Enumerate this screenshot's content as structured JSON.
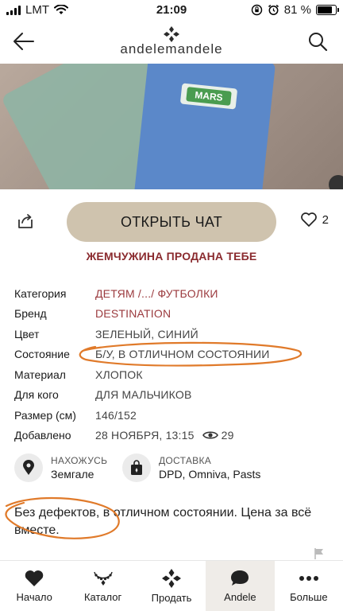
{
  "status_bar": {
    "carrier": "LMT",
    "time": "21:09",
    "battery": "81 %",
    "battery_level": 0.81
  },
  "header": {
    "logo_text": "andelemandele",
    "back_icon": "back-arrow-icon",
    "search_icon": "search-icon"
  },
  "product_image": {
    "patch_text": "MARS"
  },
  "actions": {
    "chat_label": "ОТКРЫТЬ ЧАТ",
    "like_count": "2"
  },
  "sold_note": "ЖЕМЧУЖИНА ПРОДАНА ТЕБЕ",
  "details": [
    {
      "label": "Категория",
      "value": "ДЕТЯМ /.../ ФУТБОЛКИ",
      "link": true
    },
    {
      "label": "Бренд",
      "value": "DESTINATION",
      "link": true
    },
    {
      "label": "Цвет",
      "value": "ЗЕЛЕНЫЙ, СИНИЙ",
      "link": false
    },
    {
      "label": "Состояние",
      "value": "Б/У, В ОТЛИЧНОМ СОСТОЯНИИ",
      "link": false
    },
    {
      "label": "Материал",
      "value": "ХЛОПОК",
      "link": false
    },
    {
      "label": "Для кого",
      "value": "ДЛЯ МАЛЬЧИКОВ",
      "link": false
    },
    {
      "label": "Размер (см)",
      "value": "146/152",
      "link": false
    },
    {
      "label": "Добавлено",
      "value": "28 НОЯБРЯ, 13:15",
      "link": false,
      "views": "29"
    }
  ],
  "location": {
    "title": "НАХОЖУСЬ",
    "value": "Земгале"
  },
  "delivery": {
    "title": "ДОСТАВКА",
    "value": "DPD, Omniva, Pasts"
  },
  "description": "Без дефектов, в отличном состоянии. Цена за всё вместе.",
  "tabs": [
    {
      "label": "Начало",
      "icon": "heart-icon",
      "active": false
    },
    {
      "label": "Каталог",
      "icon": "necklace-icon",
      "active": false
    },
    {
      "label": "Продать",
      "icon": "sell-diamond-icon",
      "active": false
    },
    {
      "label": "Andele",
      "icon": "chat-bubble-icon",
      "active": true
    },
    {
      "label": "Больше",
      "icon": "more-dots-icon",
      "active": false
    }
  ],
  "colors": {
    "accent": "#9b3a3e",
    "button": "#cfc3ae",
    "annotation": "#e07a2a"
  }
}
